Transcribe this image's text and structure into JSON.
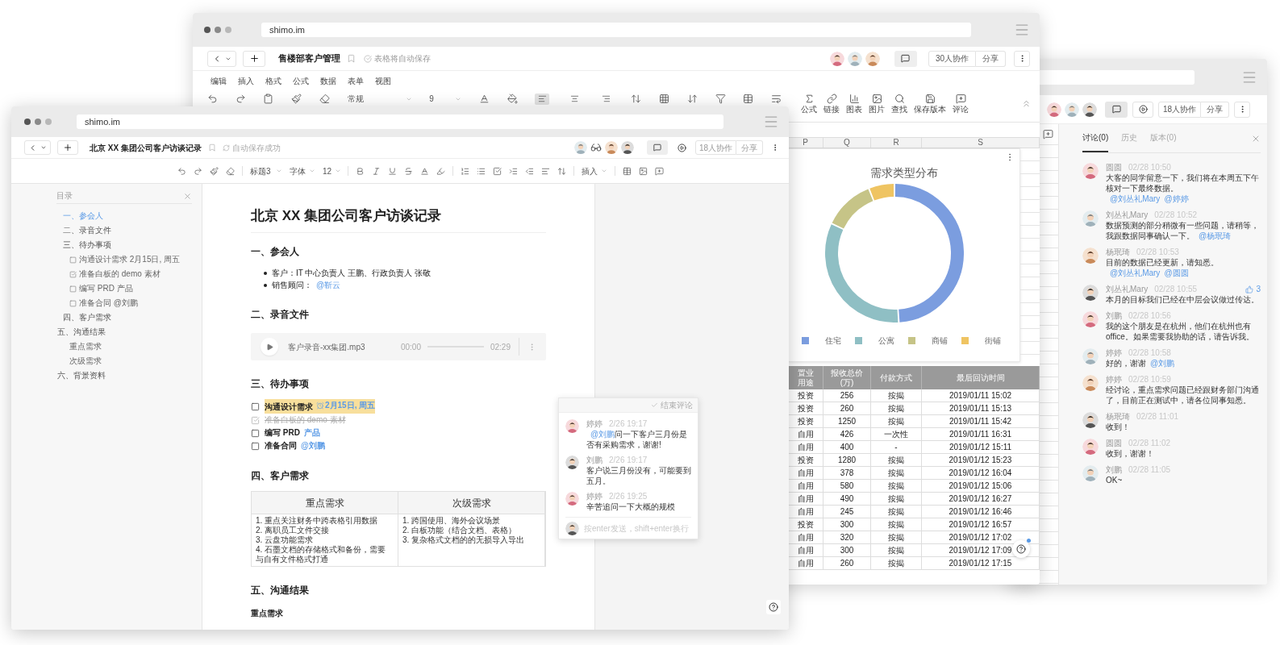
{
  "sheet_window": {
    "address": "shimo.im",
    "title": "售楼部客户管理",
    "save_status": "表格将自动保存",
    "collaborators_button": "30人协作",
    "share_button": "分享",
    "menu": [
      "编辑",
      "插入",
      "格式",
      "公式",
      "数据",
      "表单",
      "视图"
    ],
    "format_dropdowns": [
      "常规",
      "9"
    ],
    "alignments": [
      {
        "selected": true
      },
      {
        "selected": false
      },
      {
        "selected": false
      }
    ],
    "labeled_tools": [
      "公式",
      "链接",
      "图表",
      "图片",
      "查找",
      "保存版本",
      "评论"
    ],
    "columns": [
      "P",
      "Q",
      "R",
      "S"
    ],
    "chart": {
      "title": "需求类型分布",
      "legend": [
        {
          "label": "住宅",
          "color": "#7b9ddf"
        },
        {
          "label": "公寓",
          "color": "#8fbfc4"
        },
        {
          "label": "商铺",
          "color": "#c6c487"
        },
        {
          "label": "街铺",
          "color": "#efc462"
        }
      ]
    },
    "table": {
      "columns": [
        "置业用途",
        "报收总价(万)",
        "付款方式",
        "最后回访时间"
      ],
      "rows": [
        [
          "投资",
          "256",
          "按揭",
          "2019/01/11 15:02"
        ],
        [
          "投资",
          "260",
          "按揭",
          "2019/01/11 15:13"
        ],
        [
          "投资",
          "1250",
          "按揭",
          "2019/01/11 15:42"
        ],
        [
          "自用",
          "426",
          "一次性",
          "2019/01/11 16:31"
        ],
        [
          "自用",
          "400",
          "-",
          "2019/01/12 15:11"
        ],
        [
          "投资",
          "1280",
          "按揭",
          "2019/01/12 15:23"
        ],
        [
          "自用",
          "378",
          "按揭",
          "2019/01/12 16:04"
        ],
        [
          "自用",
          "580",
          "按揭",
          "2019/01/12 15:06"
        ],
        [
          "自用",
          "490",
          "按揭",
          "2019/01/12 16:27"
        ],
        [
          "自用",
          "245",
          "按揭",
          "2019/01/12 16:46"
        ],
        [
          "投资",
          "300",
          "按揭",
          "2019/01/12 16:57"
        ],
        [
          "自用",
          "320",
          "按揭",
          "2019/01/12 17:02"
        ],
        [
          "自用",
          "300",
          "按揭",
          "2019/01/12 17:09"
        ],
        [
          "自用",
          "260",
          "按揭",
          "2019/01/12 17:15"
        ]
      ]
    }
  },
  "discussion_window": {
    "collaborators_button": "18人协作",
    "share_button": "分享",
    "tabs": [
      {
        "label": "讨论(0)",
        "selected": true
      },
      {
        "label": "历史",
        "selected": false
      },
      {
        "label": "版本(0)",
        "selected": false
      }
    ],
    "comments": [
      {
        "author": "圆圆",
        "time": "02/28 10:50",
        "parts": [
          {
            "text": "大客的同学留意一下，我们将在本周五下午核对一下最终数据。"
          },
          {
            "text": "@刘丛礼Mary",
            "kind": "mention"
          },
          {
            "text": "@婷婷",
            "kind": "mention"
          }
        ]
      },
      {
        "author": "刘丛礼Mary",
        "time": "02/28 10:52",
        "parts": [
          {
            "text": "数据预测的部分稍微有一些问题，请稍等，我跟数据同事确认一下。"
          },
          {
            "text": "@杨珉琦",
            "kind": "mention"
          }
        ]
      },
      {
        "author": "杨珉琦",
        "time": "02/28 10:53",
        "parts": [
          {
            "text": "目前的数据已经更新，请知悉。"
          },
          {
            "text": "@刘丛礼Mary",
            "kind": "mention"
          },
          {
            "text": "@圆圆",
            "kind": "mention"
          }
        ]
      },
      {
        "author": "刘丛礼Mary",
        "time": "02/28 10:55",
        "likes": "3",
        "parts": [
          {
            "text": "本月的目标我们已经在中层会议做过传达。"
          }
        ]
      },
      {
        "author": "刘鹏",
        "time": "02/28 10:56",
        "parts": [
          {
            "text": "我的这个朋友是在杭州，他们在杭州也有 office。如果需要我协助的话，请告诉我。"
          }
        ]
      },
      {
        "author": "婷婷",
        "time": "02/28 10:58",
        "parts": [
          {
            "text": "好的，谢谢"
          },
          {
            "text": "@刘鹏",
            "kind": "mention"
          }
        ]
      },
      {
        "author": "婷婷",
        "time": "02/28 10:59",
        "parts": [
          {
            "text": "经讨论，重点需求问题已经跟财务部门沟通了，目前正在测试中，请各位同事知悉。"
          }
        ]
      },
      {
        "author": "杨珉琦",
        "time": "02/28 11:01",
        "parts": [
          {
            "text": "收到！"
          }
        ]
      },
      {
        "author": "圆圆",
        "time": "02/28 11:02",
        "parts": [
          {
            "text": "收到，谢谢！"
          }
        ]
      },
      {
        "author": "刘鹏",
        "time": "02/28 11:05",
        "parts": [
          {
            "text": "OK~"
          }
        ]
      }
    ]
  },
  "doc_window": {
    "address": "shimo.im",
    "title": "北京 XX 集团公司客户访谈记录",
    "save_status": "自动保存成功",
    "collaborators_button": "18人协作",
    "share_button": "分享",
    "toolbar_dropdowns": [
      "标题3",
      "字体",
      "12"
    ],
    "insert_menu": "插入",
    "outline": {
      "title": "目录",
      "items": [
        {
          "kind": "h3",
          "text": "一、参会人",
          "selected": true
        },
        {
          "kind": "h3",
          "text": "二、录音文件",
          "selected": false
        },
        {
          "kind": "h3",
          "text": "三、待办事项",
          "selected": false,
          "children": [
            {
              "kind": "todo",
              "text": "沟通设计需求 2月15日, 周五",
              "checked": false,
              "selected": false
            },
            {
              "kind": "todo",
              "text": "准备白板的 demo 素材",
              "checked": true,
              "selected": false
            },
            {
              "kind": "todo",
              "text": "编写 PRD 产品",
              "checked": false,
              "selected": false
            },
            {
              "kind": "todo",
              "text": "准备合同 @刘鹏",
              "checked": false,
              "selected": false
            }
          ]
        },
        {
          "kind": "h3",
          "text": "四、客户需求",
          "selected": false
        },
        {
          "kind": "h2",
          "text": "五、沟通结果",
          "selected": false,
          "children": [
            {
              "kind": "heading",
              "text": "重点需求",
              "selected": false
            },
            {
              "kind": "heading",
              "text": "次级需求",
              "selected": false
            }
          ]
        },
        {
          "kind": "h2",
          "text": "六、背景资料",
          "selected": false
        }
      ]
    },
    "document": {
      "title": "北京 XX 集团公司客户访谈记录",
      "blocks": [
        {
          "kind": "heading",
          "text": "一、参会人"
        },
        {
          "kind": "bullets",
          "items": [
            [
              {
                "text": "客户：IT 中心负责人 王鹏、行政负责人 张敬"
              }
            ],
            [
              {
                "text": "销售顾问："
              },
              {
                "text": "@靳云",
                "kind": "mention"
              }
            ]
          ]
        },
        {
          "kind": "heading",
          "text": "二、录音文件"
        },
        {
          "kind": "audio",
          "file": "客户录音-xx集团.mp3",
          "elapsed": "00:00",
          "duration": "02:29"
        },
        {
          "kind": "heading",
          "text": "三、待办事项"
        },
        {
          "kind": "todos",
          "items": [
            {
              "checked": false,
              "highlighted": true,
              "parts": [
                {
                  "text": "沟通设计需求"
                },
                {
                  "text": "2月15日, 周五",
                  "kind": "date"
                }
              ]
            },
            {
              "checked": true,
              "highlighted": false,
              "parts": [
                {
                  "text": "准备白板的 demo 素材"
                }
              ]
            },
            {
              "checked": false,
              "highlighted": false,
              "parts": [
                {
                  "text": "编写 PRD"
                },
                {
                  "text": "产品",
                  "kind": "tag"
                }
              ]
            },
            {
              "checked": false,
              "highlighted": false,
              "parts": [
                {
                  "text": "准备合同"
                },
                {
                  "text": "@刘鹏",
                  "kind": "mention"
                }
              ]
            }
          ]
        },
        {
          "kind": "heading",
          "text": "四、客户需求"
        },
        {
          "kind": "table",
          "columns": [
            "重点需求",
            "次级需求"
          ],
          "cells": [
            [
              "1. 重点关注财务中跨表格引用数据",
              "2. 离职员工文件交接",
              "3. 云盘功能需求",
              "4. 石墨文档的存储格式和备份，需要与自有文件格式打通"
            ],
            [
              "1. 跨国使用、海外会议场景",
              "2. 白板功能（结合文档、表格）",
              "3. 复杂格式文档的的无损导入导出"
            ]
          ]
        },
        {
          "kind": "heading",
          "text": "五、沟通结果"
        },
        {
          "kind": "subheading",
          "text": "重点需求"
        }
      ]
    },
    "comment_popup": {
      "close_button": "结束评论",
      "comments": [
        {
          "author": "婷婷",
          "time": "2/26 19:17",
          "parts": [
            {
              "text": "@刘鹏",
              "kind": "mention"
            },
            {
              "text": "问一下客户三月份是否有采购需求，谢谢!"
            }
          ]
        },
        {
          "author": "刘鹏",
          "time": "2/26 19:17",
          "parts": [
            {
              "text": "客户说三月份没有，可能要到五月。"
            }
          ]
        },
        {
          "author": "婷婷",
          "time": "2/26 19:25",
          "parts": [
            {
              "text": "辛苦追问一下大概的规模"
            }
          ]
        }
      ],
      "input_placeholder": "按enter发送，shift+enter换行"
    }
  }
}
